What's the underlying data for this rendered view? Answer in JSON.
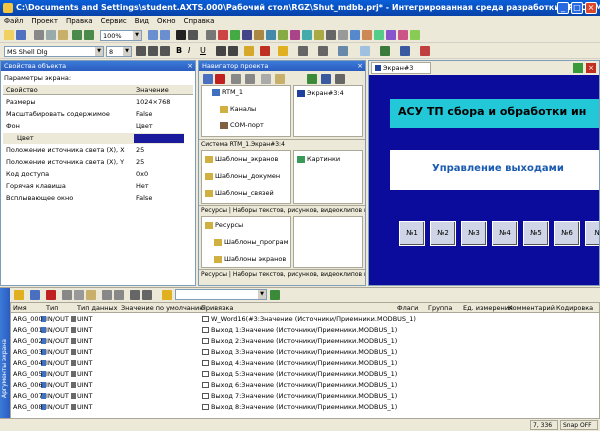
{
  "window": {
    "title": "C:\\Documents and Settings\\student.AXTS.000\\Рабочий стол\\RGZ\\Shut_mdbb.prj* - Интегрированная среда разработки TRACE MODE 6 - Шаблон..."
  },
  "menu": [
    "Файл",
    "Проект",
    "Правка",
    "Сервис",
    "Вид",
    "Окно",
    "Справка"
  ],
  "toolbar": {
    "zoom": "100%",
    "font": "MS Shell Dlg",
    "size": "8"
  },
  "props": {
    "title": "Свойства объекта",
    "subtitle": "Параметры экрана:",
    "col_prop": "Свойство",
    "col_val": "Значение",
    "rows": [
      {
        "name": "Размеры",
        "value": "1024×768"
      },
      {
        "name": "Масштабировать содержимое",
        "value": "False"
      },
      {
        "name": "Фон",
        "value": "Цвет"
      },
      {
        "name": "Цвет",
        "value": ""
      },
      {
        "name": "Положение источника света (X), X",
        "value": "25"
      },
      {
        "name": "Положение источника света (X), Y",
        "value": "25"
      },
      {
        "name": "Код доступа",
        "value": "0x0"
      },
      {
        "name": "Горячая клавиша",
        "value": "Нет"
      },
      {
        "name": "Всплывающее окно",
        "value": "False"
      }
    ],
    "color_swatch": "#1a1a9c"
  },
  "nav": {
    "title": "Навигатор проекта",
    "tree1": [
      "RTM_1",
      "Каналы",
      "COM-порт"
    ],
    "tree1_right": "Экран#3:4",
    "bar1": "Система RTM_1.Экран#3:4",
    "tree2": [
      "Шаблоны_экранов",
      "Шаблоны_докумен",
      "Шаблоны_связей"
    ],
    "tree2_right": "Картинки",
    "bar2": "Ресурсы | Наборы текстов, рисунков, видеоклипов и",
    "tree3": [
      "Ресурсы",
      "Шаблоны_програм",
      "Шаблоны экранов"
    ],
    "bar3": "Ресурсы | Наборы текстов, рисунков, видеоклипов и"
  },
  "screen": {
    "tab": "Экран#3",
    "heading": "АСУ ТП сбора и обработки ин",
    "subheading": "Управление выходами",
    "buttons": [
      "№1",
      "№2",
      "№3",
      "№4",
      "№5",
      "№6",
      "№"
    ],
    "bg_color": "#0c0c9c",
    "heading_bg": "#22c8d8"
  },
  "grid": {
    "side_label": "Аргументы экрана",
    "headers": [
      "Имя",
      "Тип",
      "Тип данных",
      "Значение по умолчанию",
      "Привязка",
      "Флаги",
      "Группа",
      "Ед. измерения",
      "Комментарий",
      "Кодировка"
    ],
    "rows": [
      {
        "name": "ARG_000",
        "type": "IN/OUT",
        "dtype": "UINT",
        "bind": "W_Word16(#3:Значение (Источники/Приемники.MODBUS_1)"
      },
      {
        "name": "ARG_001",
        "type": "IN/OUT",
        "dtype": "UINT",
        "bind": "Выход 1:Значение (Источники/Приемники.MODBUS_1)"
      },
      {
        "name": "ARG_002",
        "type": "IN/OUT",
        "dtype": "UINT",
        "bind": "Выход 2:Значение (Источники/Приемники.MODBUS_1)"
      },
      {
        "name": "ARG_003",
        "type": "IN/OUT",
        "dtype": "UINT",
        "bind": "Выход 3:Значение (Источники/Приемники.MODBUS_1)"
      },
      {
        "name": "ARG_004",
        "type": "IN/OUT",
        "dtype": "UINT",
        "bind": "Выход 4:Значение (Источники/Приемники.MODBUS_1)"
      },
      {
        "name": "ARG_005",
        "type": "IN/OUT",
        "dtype": "UINT",
        "bind": "Выход 5:Значение (Источники/Приемники.MODBUS_1)"
      },
      {
        "name": "ARG_006",
        "type": "IN/OUT",
        "dtype": "UINT",
        "bind": "Выход 6:Значение (Источники/Приемники.MODBUS_1)"
      },
      {
        "name": "ARG_007",
        "type": "IN/OUT",
        "dtype": "UINT",
        "bind": "Выход 7:Значение (Источники/Приемники.MODBUS_1)"
      },
      {
        "name": "ARG_008",
        "type": "IN/OUT",
        "dtype": "UINT",
        "bind": "Выход 8:Значение (Источники/Приемники.MODBUS_1)"
      }
    ]
  },
  "status": {
    "coords": "7, 336",
    "snap": "Snap OFF"
  }
}
